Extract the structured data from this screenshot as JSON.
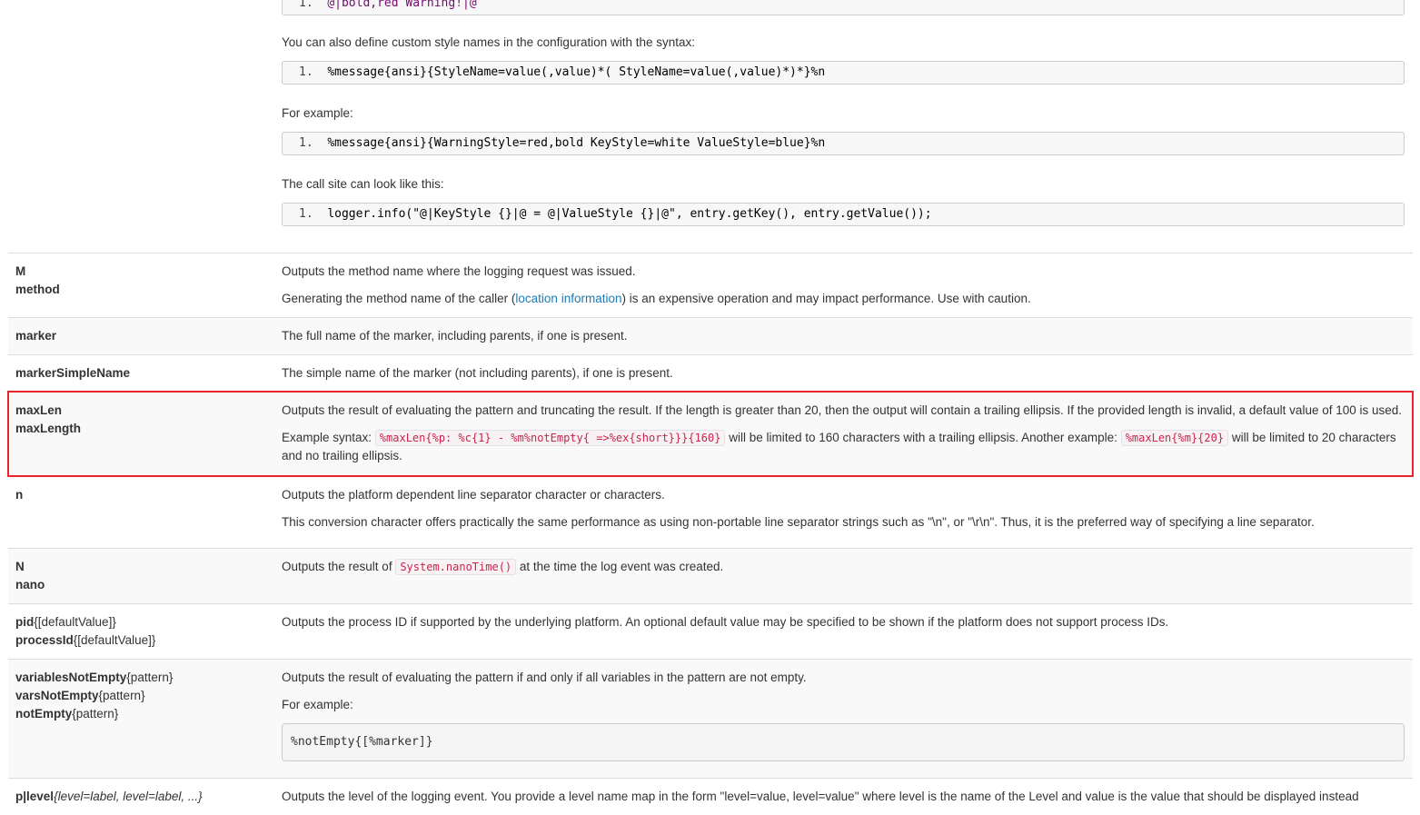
{
  "top": {
    "code0": "@|bold,red Warning!|@",
    "p1": "You can also define custom style names in the configuration with the syntax:",
    "code1": "%message{ansi}{StyleName=value(,value)*( StyleName=value(,value)*)*}%n",
    "p2": "For example:",
    "code2": "%message{ansi}{WarningStyle=red,bold KeyStyle=white ValueStyle=blue}%n",
    "p3": "The call site can look like this:",
    "code3": "logger.info(\"@|KeyStyle {}|@ = @|ValueStyle {}|@\", entry.getKey(), entry.getValue());",
    "line_no": "1."
  },
  "rows": {
    "method": {
      "k1": "M",
      "k2": "method",
      "d1": "Outputs the method name where the logging request was issued.",
      "d2a": "Generating the method name of the caller (",
      "link": "location information",
      "d2b": ") is an expensive operation and may impact performance. Use with caution."
    },
    "marker": {
      "k1": "marker",
      "d1": "The full name of the marker, including parents, if one is present."
    },
    "markerSimple": {
      "k1": "markerSimpleName",
      "d1": "The simple name of the marker (not including parents), if one is present."
    },
    "maxLen": {
      "k1": "maxLen",
      "k2": "maxLength",
      "d1": "Outputs the result of evaluating the pattern and truncating the result. If the length is greater than 20, then the output will contain a trailing ellipsis. If the provided length is invalid, a default value of 100 is used.",
      "d2a": "Example syntax: ",
      "c1": "%maxLen{%p: %c{1} - %m%notEmpty{ =>%ex{short}}}{160}",
      "d2b": " will be limited to 160 characters with a trailing ellipsis. Another example: ",
      "c2": "%maxLen{%m}{20}",
      "d2c": " will be limited to 20 characters and no trailing ellipsis."
    },
    "n": {
      "k1": "n",
      "d1": "Outputs the platform dependent line separator character or characters.",
      "d2": "This conversion character offers practically the same performance as using non-portable line separator strings such as \"\\n\", or \"\\r\\n\". Thus, it is the preferred way of specifying a line separator."
    },
    "nano": {
      "k1": "N",
      "k2": "nano",
      "d1a": "Outputs the result of ",
      "c1": "System.nanoTime()",
      "d1b": " at the time the log event was created."
    },
    "pid": {
      "k1": "pid",
      "k1s": "{[defaultValue]}",
      "k2": "processId",
      "k2s": "{[defaultValue]}",
      "d1": "Outputs the process ID if supported by the underlying platform. An optional default value may be specified to be shown if the platform does not support process IDs."
    },
    "notEmpty": {
      "k1": "variablesNotEmpty",
      "k1s": "{pattern}",
      "k2": "varsNotEmpty",
      "k2s": "{pattern}",
      "k3": "notEmpty",
      "k3s": "{pattern}",
      "d1": "Outputs the result of evaluating the pattern if and only if all variables in the pattern are not empty.",
      "d2": "For example:",
      "pre": "%notEmpty{[%marker]}"
    },
    "level": {
      "k1": "p|level",
      "k1s": "{level=label, level=label, ...}",
      "d1": "Outputs the level of the logging event. You provide a level name map in the form \"level=value, level=value\" where level is the name of the Level and value is the value that should be displayed instead"
    }
  }
}
